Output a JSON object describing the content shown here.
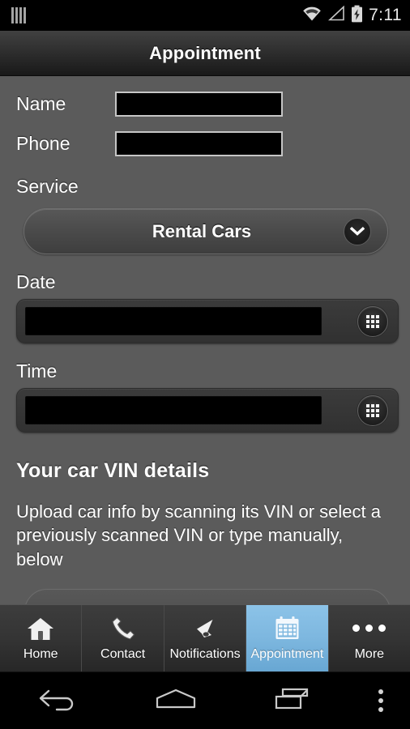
{
  "statusbar": {
    "sim_icon": "sim-bars-icon",
    "wifi_icon": "wifi-icon",
    "signal_icon": "signal-triangle-icon",
    "battery_icon": "battery-charging-icon",
    "time": "7:11"
  },
  "titlebar": {
    "title": "Appointment"
  },
  "form": {
    "name": {
      "label": "Name",
      "value": "",
      "placeholder": ""
    },
    "phone": {
      "label": "Phone",
      "value": "",
      "placeholder": ""
    },
    "service": {
      "label": "Service",
      "selected": "Rental Cars",
      "chevron_icon": "chevron-down-icon",
      "options": [
        "Rental Cars"
      ]
    },
    "date": {
      "label": "Date",
      "value": "",
      "placeholder": "",
      "picker_icon": "grid-picker-icon"
    },
    "time": {
      "label": "Time",
      "value": "",
      "placeholder": "",
      "picker_icon": "grid-picker-icon"
    }
  },
  "vin": {
    "heading": "Your car VIN details",
    "description": "Upload car info by scanning its VIN or select a previously scanned VIN or type manually, below"
  },
  "tabbar": {
    "active_color": "#7db7df",
    "items": [
      {
        "label": "Home",
        "icon": "home-icon",
        "active": false
      },
      {
        "label": "Contact",
        "icon": "phone-icon",
        "active": false
      },
      {
        "label": "Notifications",
        "icon": "megaphone-icon",
        "active": false
      },
      {
        "label": "Appointment",
        "icon": "calendar-icon",
        "active": true
      },
      {
        "label": "More",
        "icon": "ellipsis-icon",
        "active": false
      }
    ]
  },
  "navbar": {
    "back_icon": "back-arrow-icon",
    "home_icon": "home-pentagon-icon",
    "recents_icon": "recent-apps-icon",
    "overflow_icon": "overflow-menu-icon"
  }
}
